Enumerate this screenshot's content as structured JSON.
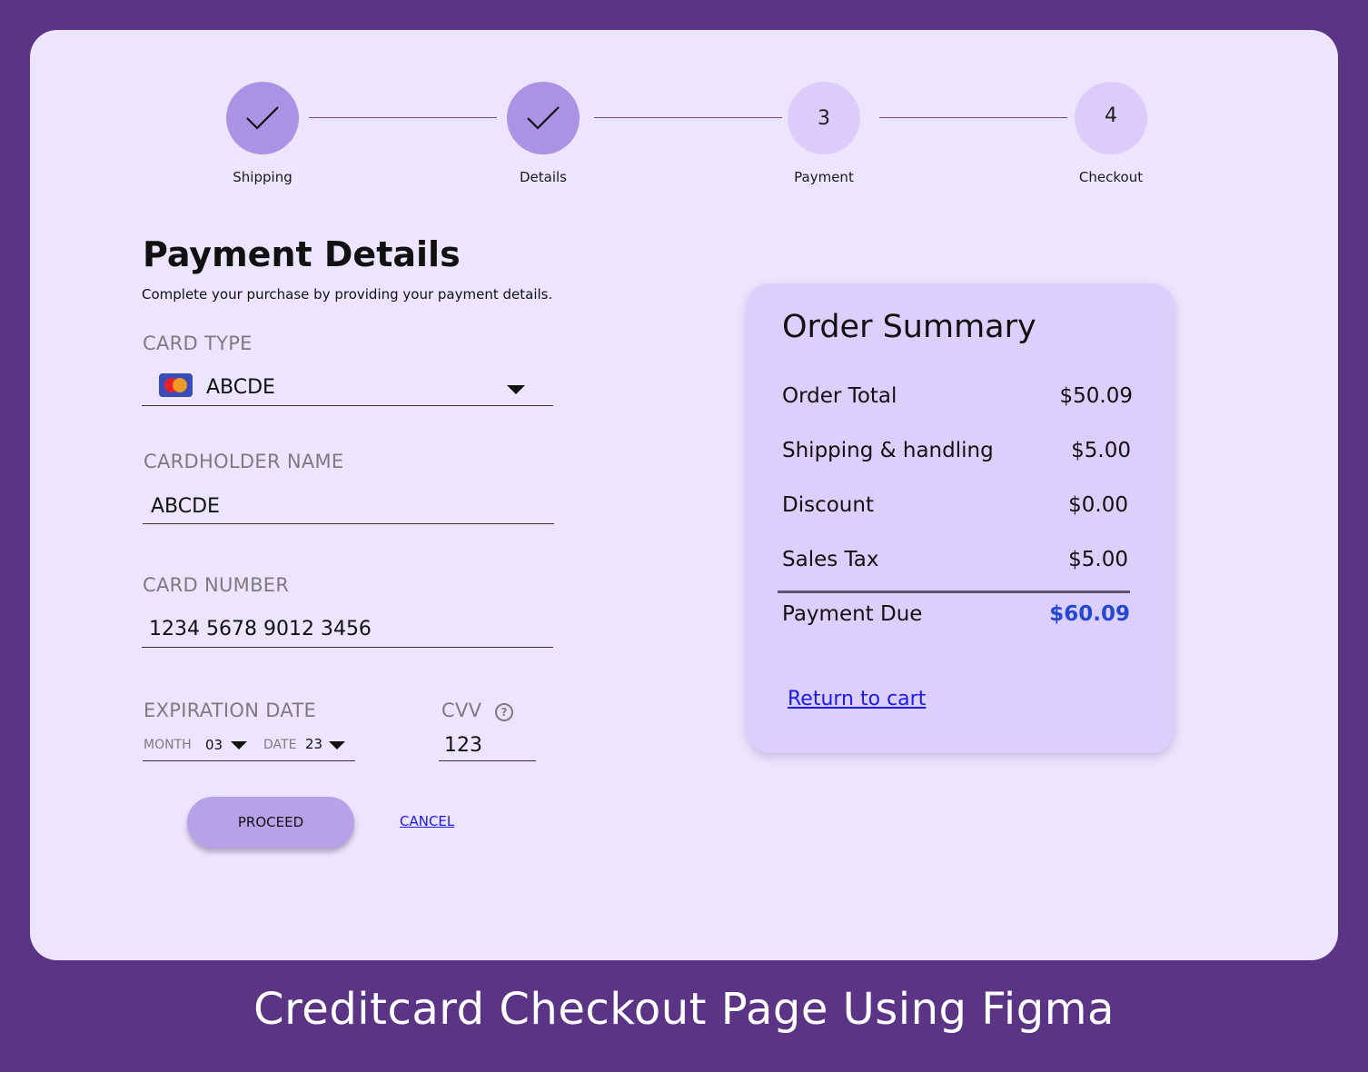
{
  "stepper": {
    "steps": [
      {
        "label": "Shipping",
        "number": "",
        "status": "done"
      },
      {
        "label": "Details",
        "number": "",
        "status": "done"
      },
      {
        "label": "Payment",
        "number": "3",
        "status": "current"
      },
      {
        "label": "Checkout",
        "number": "4",
        "status": "todo"
      }
    ]
  },
  "form": {
    "title": "Payment Details",
    "subtitle": "Complete your purchase by providing your payment details.",
    "card_type": {
      "label": "CARD TYPE",
      "value": "ABCDE",
      "icon": "credit-card-icon"
    },
    "cardholder": {
      "label": "CARDHOLDER NAME",
      "value": "ABCDE"
    },
    "card_number": {
      "label": "CARD NUMBER",
      "value": "1234 5678 9012 3456"
    },
    "expiration": {
      "label": "EXPIRATION DATE",
      "month_label": "MONTH",
      "month_value": "03",
      "date_label": "DATE",
      "date_value": "23"
    },
    "cvv": {
      "label": "CVV",
      "value": "123",
      "help_icon": "?"
    },
    "proceed_label": "PROCEED",
    "cancel_label": "CANCEL"
  },
  "summary": {
    "title": "Order Summary",
    "rows": [
      {
        "label": "Order Total",
        "value": "$50.09"
      },
      {
        "label": "Shipping & handling",
        "value": "$5.00"
      },
      {
        "label": "Discount",
        "value": "$0.00"
      },
      {
        "label": "Sales Tax",
        "value": "$5.00"
      }
    ],
    "due": {
      "label": "Payment Due",
      "value": "$60.09"
    },
    "return_link": "Return to cart"
  },
  "caption": "Creditcard Checkout Page Using Figma",
  "colors": {
    "background": "#5b3486",
    "card": "#ede5fd",
    "step_done": "#ac92e5",
    "step_todo": "#ddccfb",
    "summary_bg": "#dccffc",
    "accent_due": "#2548d0",
    "button": "#b8a1e9",
    "link": "#1a1aee"
  }
}
